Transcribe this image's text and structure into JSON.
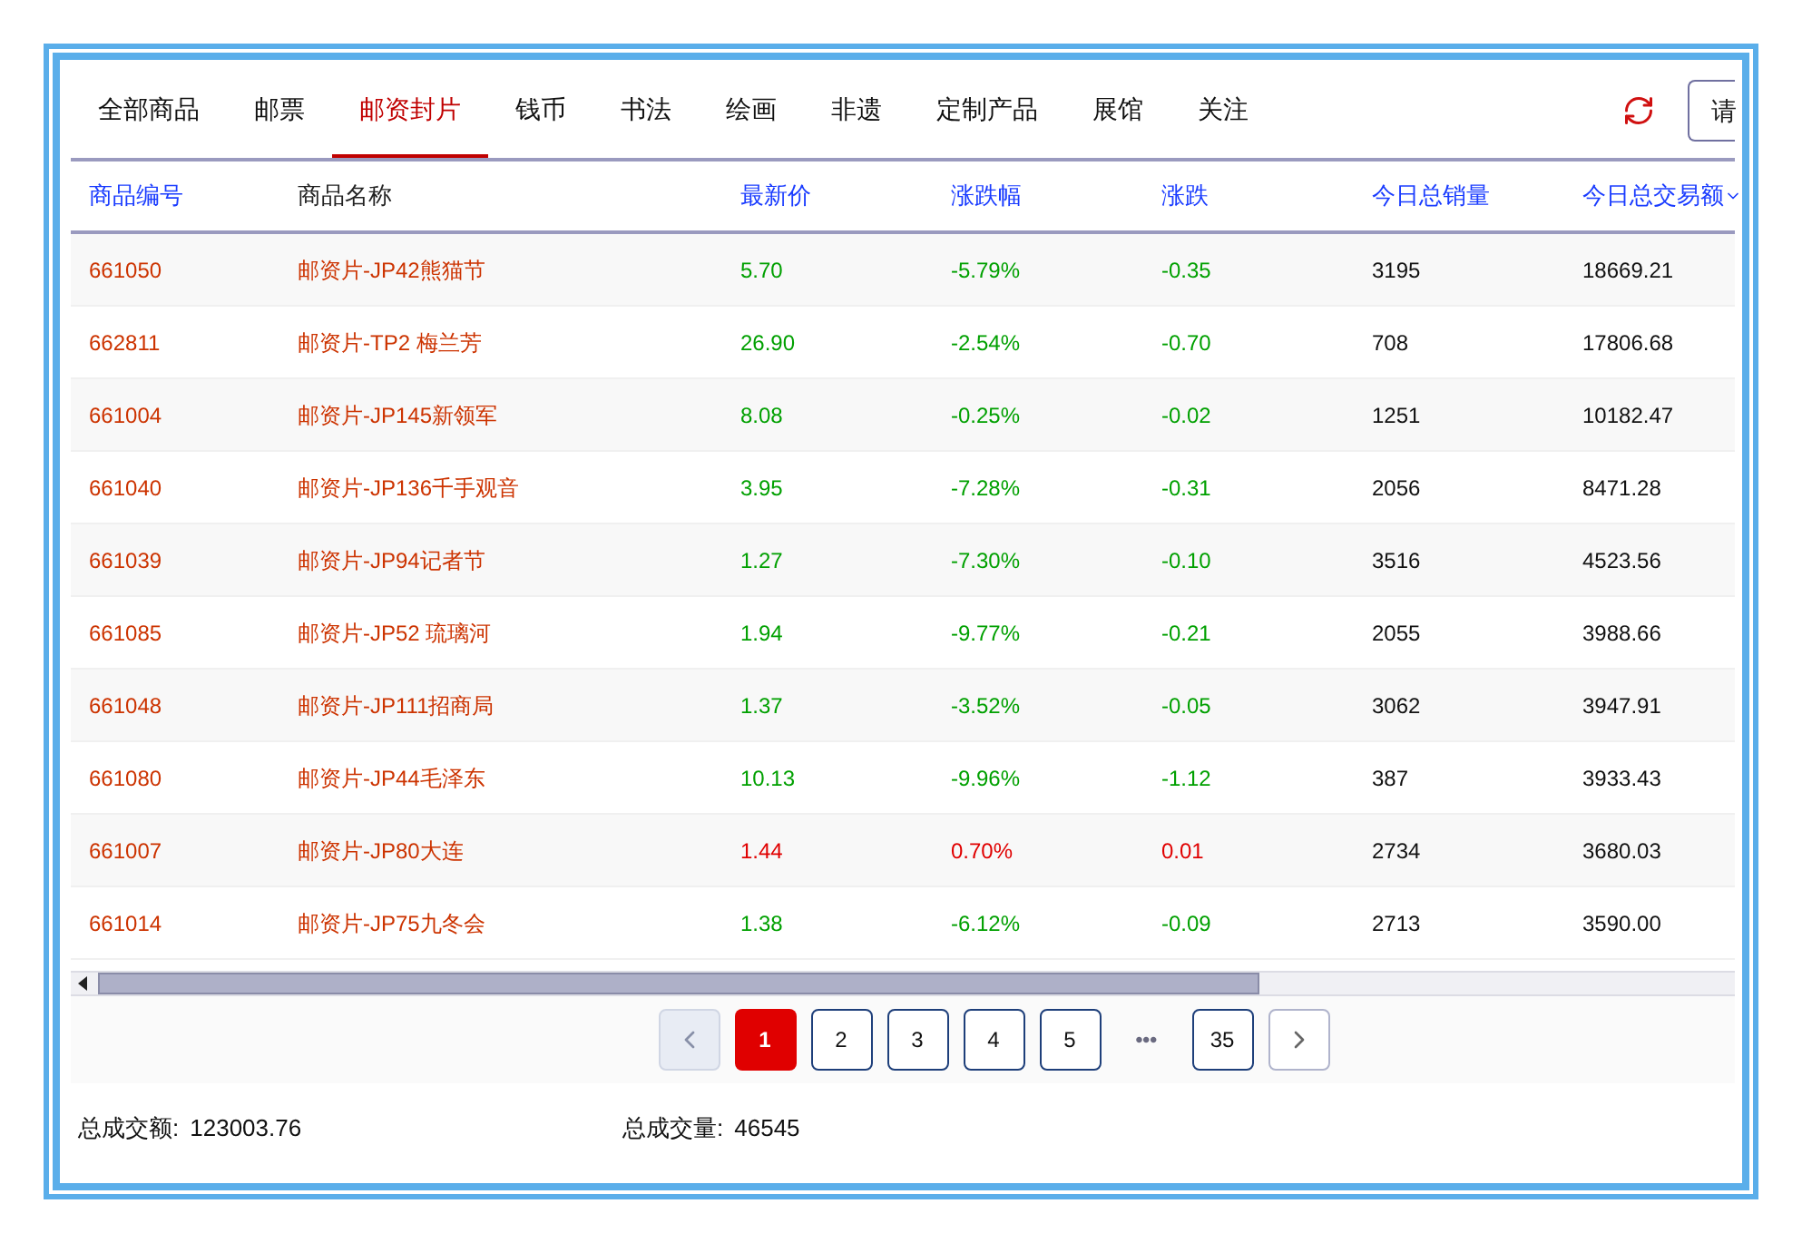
{
  "tabs": [
    {
      "label": "全部商品",
      "selected": false
    },
    {
      "label": "邮票",
      "selected": false
    },
    {
      "label": "邮资封片",
      "selected": true
    },
    {
      "label": "钱币",
      "selected": false
    },
    {
      "label": "书法",
      "selected": false
    },
    {
      "label": "绘画",
      "selected": false
    },
    {
      "label": "非遗",
      "selected": false
    },
    {
      "label": "定制产品",
      "selected": false
    },
    {
      "label": "展馆",
      "selected": false
    },
    {
      "label": "关注",
      "selected": false
    }
  ],
  "search_button": {
    "label": "请"
  },
  "table": {
    "columns": [
      "商品编号",
      "商品名称",
      "最新价",
      "涨跌幅",
      "涨跌",
      "今日总销量",
      "今日总交易额"
    ],
    "rows": [
      {
        "code": "661050",
        "name": "邮资片-JP42熊猫节",
        "price": "5.70",
        "pct": "-5.79%",
        "change": "-0.35",
        "volume": "3195",
        "amount": "18669.21",
        "rising": false
      },
      {
        "code": "662811",
        "name": "邮资片-TP2 梅兰芳",
        "price": "26.90",
        "pct": "-2.54%",
        "change": "-0.70",
        "volume": "708",
        "amount": "17806.68",
        "rising": false
      },
      {
        "code": "661004",
        "name": "邮资片-JP145新领军",
        "price": "8.08",
        "pct": "-0.25%",
        "change": "-0.02",
        "volume": "1251",
        "amount": "10182.47",
        "rising": false
      },
      {
        "code": "661040",
        "name": "邮资片-JP136千手观音",
        "price": "3.95",
        "pct": "-7.28%",
        "change": "-0.31",
        "volume": "2056",
        "amount": "8471.28",
        "rising": false
      },
      {
        "code": "661039",
        "name": "邮资片-JP94记者节",
        "price": "1.27",
        "pct": "-7.30%",
        "change": "-0.10",
        "volume": "3516",
        "amount": "4523.56",
        "rising": false
      },
      {
        "code": "661085",
        "name": "邮资片-JP52 琉璃河",
        "price": "1.94",
        "pct": "-9.77%",
        "change": "-0.21",
        "volume": "2055",
        "amount": "3988.66",
        "rising": false
      },
      {
        "code": "661048",
        "name": "邮资片-JP111招商局",
        "price": "1.37",
        "pct": "-3.52%",
        "change": "-0.05",
        "volume": "3062",
        "amount": "3947.91",
        "rising": false
      },
      {
        "code": "661080",
        "name": "邮资片-JP44毛泽东",
        "price": "10.13",
        "pct": "-9.96%",
        "change": "-1.12",
        "volume": "387",
        "amount": "3933.43",
        "rising": false
      },
      {
        "code": "661007",
        "name": "邮资片-JP80大连",
        "price": "1.44",
        "pct": "0.70%",
        "change": "0.01",
        "volume": "2734",
        "amount": "3680.03",
        "rising": true
      },
      {
        "code": "661014",
        "name": "邮资片-JP75九冬会",
        "price": "1.38",
        "pct": "-6.12%",
        "change": "-0.09",
        "volume": "2713",
        "amount": "3590.00",
        "rising": false
      }
    ]
  },
  "pagination": {
    "pages": [
      {
        "label": "1",
        "selected": true
      },
      {
        "label": "2",
        "selected": false
      },
      {
        "label": "3",
        "selected": false
      },
      {
        "label": "4",
        "selected": false
      },
      {
        "label": "5",
        "selected": false
      },
      {
        "label": "35",
        "selected": false
      }
    ],
    "ellipsis": "•••"
  },
  "totals": [
    {
      "label": "总成交额:",
      "value": "123003.76"
    },
    {
      "label": "总成交量:",
      "value": "46545"
    }
  ]
}
